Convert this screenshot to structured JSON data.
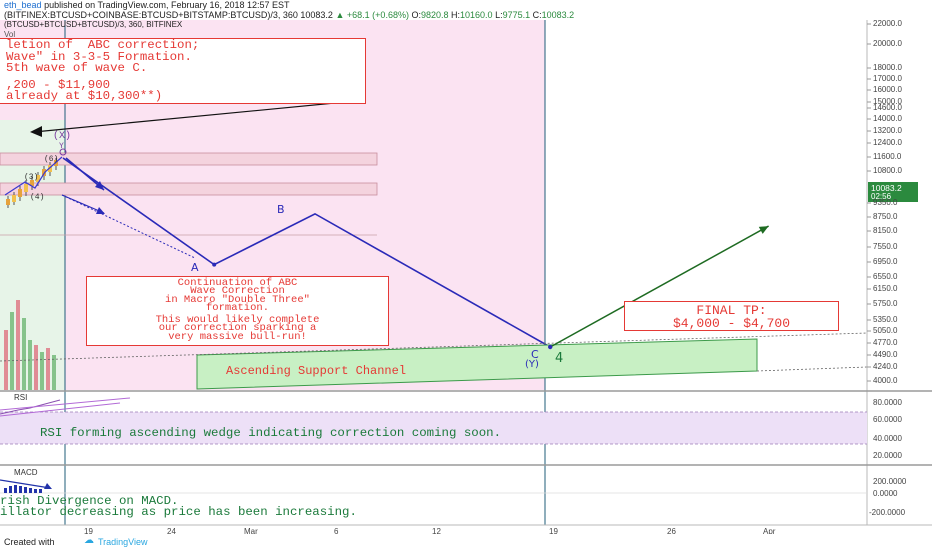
{
  "header": {
    "author": "eth_bead",
    "published_text": "published on TradingView.com, February 16, 2018 12:57 EST",
    "symbol": "(BTCUSD+BTCUSD+BTCUSD)/3, 360, BITFINEX",
    "formula": "(BITFINEX:BTCUSD+COINBASE:BTCUSD+BITSTAMP:BTCUSD)/3, 360",
    "last": "10083.2",
    "change": "+68.1 (+0.68%)",
    "open_label": "O:",
    "open": "9820.8",
    "high_label": "H:",
    "high": "10160.0",
    "low_label": "L:",
    "low": "9775.1",
    "close_label": "C:",
    "close": "10083.2",
    "vol_label": "Vol"
  },
  "annotations": {
    "top_box": [
      "letion of  ABC correction;",
      "Wave\" in 3-3-5 Formation.",
      "5th wave of wave C.",
      "",
      ",200 - $11,900",
      "already at $10,300**)"
    ],
    "mid_box": [
      "Continuation of ABC",
      "Wave Correction",
      "in Macro \"Double Three\"",
      "formation.",
      "",
      "This would likely complete",
      "our correction sparking a",
      "very massive bull-run!"
    ],
    "tp_box": [
      "FINAL TP:",
      "$4,000 - $4,700"
    ],
    "channel": "Ascending Support Channel",
    "wave_labels": {
      "x": "(X)",
      "y_small": "Y",
      "w6": "(6)",
      "w3": "(3)",
      "w4": "(4)",
      "a": "A",
      "b": "B",
      "c": "C",
      "y": "(Y)",
      "four": "4"
    },
    "rsi_text": "RSI forming ascending wedge indicating correction coming soon.",
    "macd_text_1": "rish Divergence on MACD.",
    "macd_text_2": "illator decreasing as price has been increasing."
  },
  "price_axis": {
    "ticks": [
      "22000.0",
      "20000.0",
      "18000.0",
      "17000.0",
      "16000.0",
      "15000.0",
      "14600.0",
      "14000.0",
      "13200.0",
      "12400.0",
      "11600.0",
      "10800.0",
      "9350.0",
      "8750.0",
      "8150.0",
      "7550.0",
      "6950.0",
      "6550.0",
      "6150.0",
      "5750.0",
      "5350.0",
      "5050.0",
      "4770.0",
      "4490.0",
      "4240.0",
      "4000.0"
    ],
    "current_price": "10083.2",
    "countdown": "02:56"
  },
  "rsi_panel": {
    "label": "RSI",
    "ticks": [
      "80.0000",
      "60.0000",
      "40.0000",
      "20.0000"
    ]
  },
  "macd_panel": {
    "label": "MACD",
    "ticks": [
      "200.0000",
      "0.0000",
      "-200.0000"
    ]
  },
  "time_axis": {
    "ticks": [
      "19",
      "24",
      "Mar",
      "6",
      "12",
      "19",
      "26",
      "Apr"
    ]
  },
  "footer": {
    "created_with": "Created with",
    "brand": "TradingView"
  },
  "colors": {
    "pink_bg": "#fbe3f2",
    "wave_line": "#2a2ab8",
    "projection": "#1e6b22",
    "annotation_red": "#e53935",
    "channel_fill": "#c8f0c4",
    "rsi_band": "#ede0f7"
  },
  "chart_data": {
    "type": "line",
    "price_path": {
      "labels": [
        "(X)",
        "A",
        "B",
        "C (Y)"
      ],
      "x": [
        "2018-02-16",
        "2018-02-25",
        "2018-03-03",
        "2018-03-17"
      ],
      "values": [
        11500,
        6900,
        8800,
        4650
      ]
    },
    "projection": {
      "x": [
        "2018-03-17",
        "2018-03-30"
      ],
      "values": [
        4650,
        8300
      ]
    },
    "target_range": [
      4000,
      4700
    ],
    "ylim": [
      3900,
      22500
    ],
    "yscale": "log"
  }
}
